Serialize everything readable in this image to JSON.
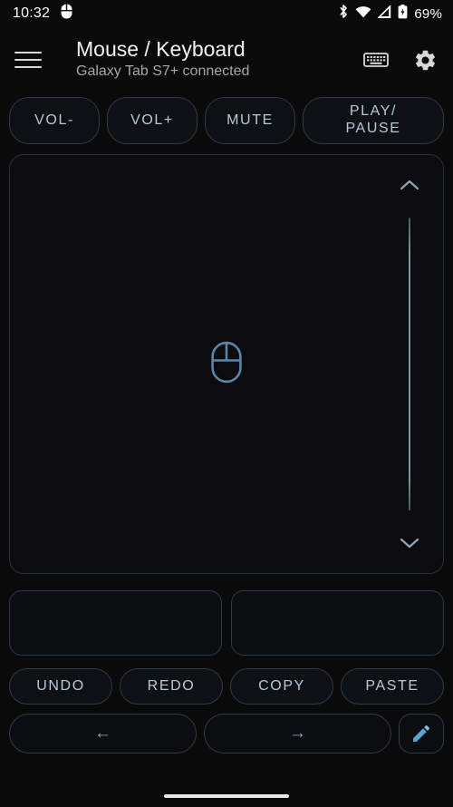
{
  "status_bar": {
    "clock": "10:32",
    "battery_text": "69%",
    "icons": [
      "mouse-notification-icon",
      "bluetooth-icon",
      "wifi-icon",
      "cellular-signal-icon",
      "battery-icon"
    ]
  },
  "header": {
    "menu_icon": "hamburger-menu-icon",
    "title": "Mouse / Keyboard",
    "subtitle": "Galaxy Tab S7+ connected",
    "keyboard_icon": "keyboard-icon",
    "settings_icon": "gear-icon"
  },
  "media_controls": {
    "vol_down": "VOL-",
    "vol_up": "VOL+",
    "mute": "MUTE",
    "play_pause_line1": "PLAY/",
    "play_pause_line2": "PAUSE"
  },
  "trackpad": {
    "emblem_icon": "mouse-icon",
    "scroll_up_icon": "chevron-up-icon",
    "scroll_down_icon": "chevron-down-icon"
  },
  "click_buttons": {
    "left": "",
    "right": ""
  },
  "edit_controls": {
    "undo": "UNDO",
    "redo": "REDO",
    "copy": "COPY",
    "paste": "PASTE"
  },
  "nav_controls": {
    "back": "←",
    "forward": "→",
    "pencil_icon": "pencil-icon"
  },
  "system_nav": {
    "home_pill": "gesture-home-pill"
  },
  "colors": {
    "background": "#0a0a0a",
    "accent": "#7fb2d8",
    "button_border": "#2e3a47",
    "button_text": "#b9c9d8",
    "title_text": "#f2f2f2",
    "subtitle_text": "#a6a6a6"
  }
}
